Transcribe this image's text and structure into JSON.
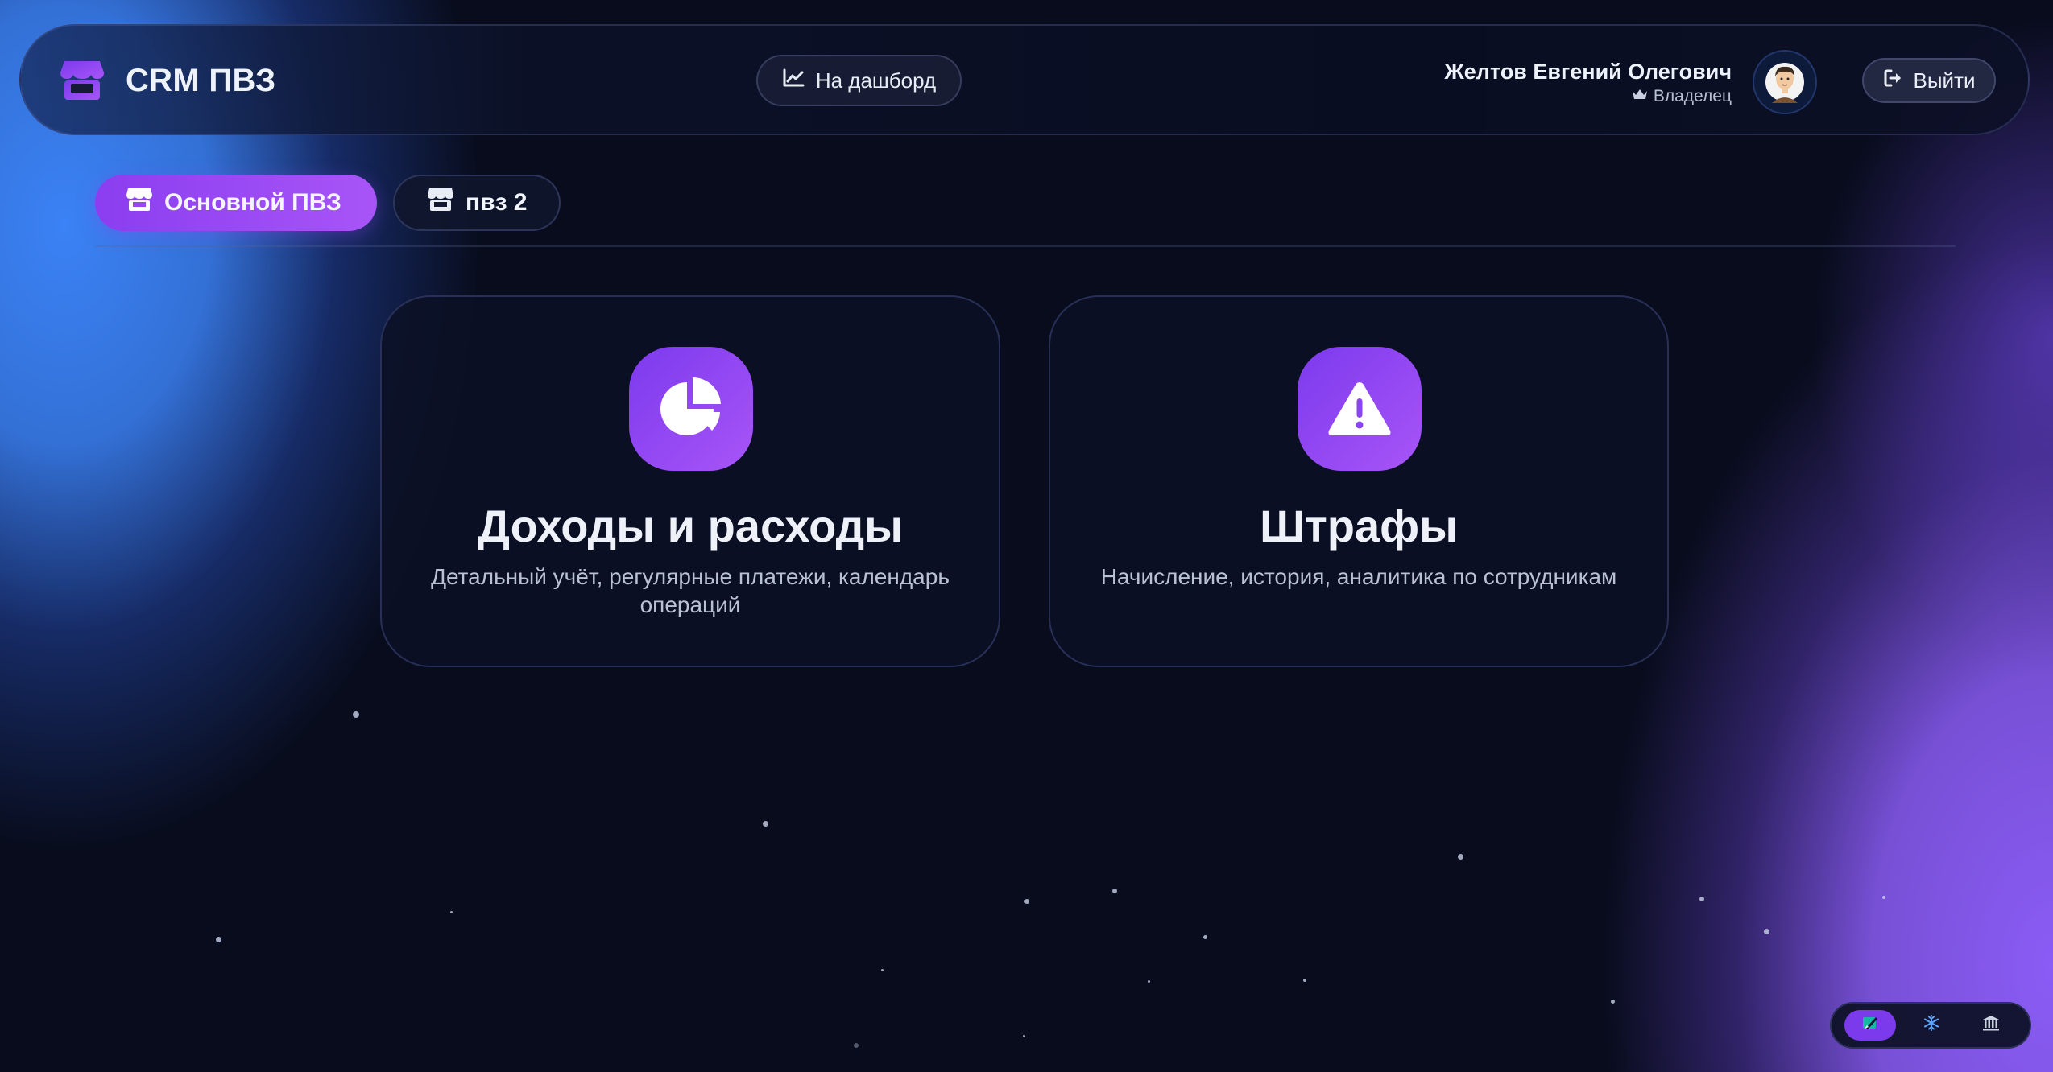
{
  "app": {
    "title": "CRM ПВЗ"
  },
  "header": {
    "dashboard_label": "На дашборд",
    "user_name": "Желтов Евгений Олегович",
    "user_role": "Владелец",
    "logout_label": "Выйти"
  },
  "tabs": [
    {
      "label": "Основной ПВЗ",
      "active": true
    },
    {
      "label": "пвз 2",
      "active": false
    }
  ],
  "cards": [
    {
      "icon": "pie-chart-icon",
      "title": "Доходы и расходы",
      "description": "Детальный учёт, регулярные платежи, календарь операций"
    },
    {
      "icon": "warning-icon",
      "title": "Штрафы",
      "description": "Начисление, история, аналитика по сотрудникам"
    }
  ],
  "mode_switch": {
    "items": [
      {
        "icon": "theme-brush-icon",
        "active": true
      },
      {
        "icon": "snowflake-icon",
        "active": false
      },
      {
        "icon": "bank-icon",
        "active": false
      }
    ]
  },
  "colors": {
    "accent": "#8b3ef0",
    "accent_light": "#a855f7",
    "background": "#080c1c",
    "glow_blue": "#3b82f6",
    "glow_purple": "#8b5cf6"
  }
}
